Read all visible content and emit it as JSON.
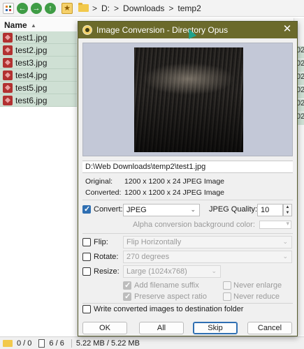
{
  "fileManager": {
    "toolbar": {
      "nav_back": "←",
      "nav_forward": "→",
      "nav_up": "↑",
      "favorite": "★"
    },
    "breadcrumbs": [
      "D:",
      "Downloads",
      "temp2"
    ],
    "breadcrumb_sep": ">",
    "column_name": "Name",
    "files": [
      "test1.jpg",
      "test2.jpg",
      "test3.jpg",
      "test4.jpg",
      "test5.jpg",
      "test6.jpg"
    ],
    "partial_cells": [
      "02",
      "02",
      "02",
      "02",
      "02",
      "02"
    ],
    "status": {
      "folders": "0 / 0",
      "files": "6 / 6",
      "size": "5.22 MB / 5.22 MB"
    }
  },
  "dialog": {
    "title": "Image Conversion - Directory Opus",
    "close": "✕",
    "path": "D:\\Web Downloads\\temp2\\test1.jpg",
    "original_label": "Original:",
    "original_value": "1200 x 1200 x 24 JPEG Image",
    "converted_label": "Converted:",
    "converted_value": "1200 x 1200 x 24 JPEG Image",
    "convert": {
      "label": "Convert:",
      "checked": true,
      "format": "JPEG"
    },
    "quality": {
      "label": "JPEG Quality:",
      "value": "10"
    },
    "alpha_label": "Alpha conversion background color:",
    "flip": {
      "label": "Flip:",
      "checked": false,
      "value": "Flip Horizontally"
    },
    "rotate": {
      "label": "Rotate:",
      "checked": false,
      "value": "270 degrees"
    },
    "resize": {
      "label": "Resize:",
      "checked": false,
      "value": "Large (1024x768)"
    },
    "add_suffix": {
      "label": "Add filename suffix",
      "checked": true
    },
    "preserve_aspect": {
      "label": "Preserve aspect ratio",
      "checked": true
    },
    "never_enlarge": {
      "label": "Never enlarge",
      "checked": false
    },
    "never_reduce": {
      "label": "Never reduce",
      "checked": false
    },
    "write_dest": {
      "label": "Write converted images to destination folder",
      "checked": false
    },
    "buttons": {
      "ok": "OK",
      "all": "All",
      "skip": "Skip",
      "cancel": "Cancel"
    }
  }
}
